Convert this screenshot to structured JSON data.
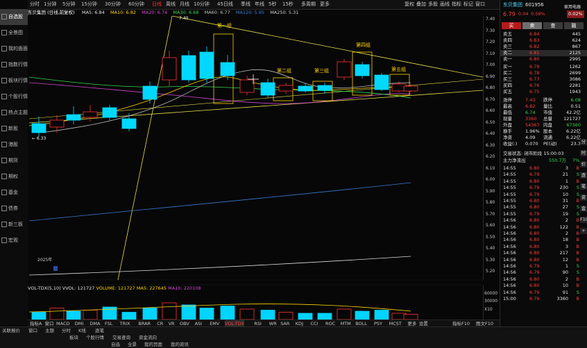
{
  "sidebar": {
    "items": [
      {
        "label": "自选股",
        "active": true
      },
      {
        "label": "全景图"
      },
      {
        "label": "我的面面"
      },
      {
        "label": "指数行情"
      },
      {
        "label": "板块行情"
      },
      {
        "label": "个股行情"
      },
      {
        "label": "热点主题"
      },
      {
        "label": "新股"
      },
      {
        "label": "港股"
      },
      {
        "label": "期货"
      },
      {
        "label": "期权"
      },
      {
        "label": "基金"
      },
      {
        "label": "债券"
      },
      {
        "label": "新三板"
      },
      {
        "label": "宏观"
      }
    ]
  },
  "toolbar": {
    "periods": [
      "分时",
      "1分钟",
      "5分钟",
      "15分钟",
      "30分钟",
      "60分钟",
      "日线",
      "周线",
      "月线",
      "10分钟",
      "45日线",
      "季线",
      "年线",
      "5秒",
      "15秒",
      "多周期",
      "更多"
    ],
    "active_period": "日线",
    "right": [
      "复权",
      "叠加",
      "多股",
      "画线",
      "指标",
      "标记",
      "窗口"
    ]
  },
  "header": {
    "title": "东贝集团 (日线,前复权)",
    "ma5": "MA5: 6.84",
    "ma10": "MA10: 6.82",
    "ma20": "MA20: 6.74",
    "ma30": "MA30: 6.68",
    "ma60": "MA60: 6.77",
    "ma120": "MA120: 5.95",
    "ma250": "MA250: 5.31"
  },
  "annotations": {
    "high_label": "7.40",
    "low_label": "← 6.33",
    "group1": "第一组",
    "group2": "第二组",
    "group3": "第三组",
    "group4": "第四组",
    "group5": "第五组",
    "year_label": "2025年"
  },
  "price_axis": [
    "7.40",
    "7.30",
    "7.20",
    "7.10",
    "7.00",
    "6.90",
    "6.80",
    "6.70",
    "6.60",
    "6.50",
    "6.40",
    "6.30",
    "6.20",
    "6.10",
    "6.00",
    "5.90",
    "5.80",
    "5.70",
    "5.60",
    "5.50",
    "5.40",
    "5.30",
    "5.20"
  ],
  "volume": {
    "header_name": "VOL-TDX(5,10)",
    "vvol": "VVOL: 121727",
    "volume": "VOLUME: 121727",
    "ma5": "MA5: 227645",
    "ma10": "MA10: 220108",
    "axis": [
      "60000",
      "30000",
      "X10"
    ],
    "colors": {
      "up": "#ff3333",
      "down": "#00d4ff",
      "ma5": "#e0e0e0",
      "ma10": "#ffd400"
    }
  },
  "indicator_tabs": [
    "指标A",
    "窗口",
    "MACD",
    "DMI",
    "DMA",
    "FSL",
    "TRIX",
    "BRAR",
    "CR",
    "VR",
    "OBV",
    "ASI",
    "EMV",
    "VOL-TDX",
    "RSI",
    "WR",
    "SAR",
    "KDJ",
    "CCI",
    "ROC",
    "MTM",
    "BOLL",
    "PSY",
    "MCST",
    "更多",
    "设置"
  ],
  "indicator_active": "VOL-TDX",
  "indicator_right": [
    "指标F10",
    "图文F10"
  ],
  "quote": {
    "name": "东贝集团",
    "code": "601956",
    "price": "6.79",
    "change": "0.04",
    "pct": "0.59%",
    "tag": "家用电器",
    "tag_pct": "0.02%",
    "buttons": [
      "买",
      "卖",
      "查",
      "融"
    ],
    "asks": [
      {
        "label": "卖五",
        "price": "6.84",
        "vol": "445"
      },
      {
        "label": "卖四",
        "price": "6.83",
        "vol": "624"
      },
      {
        "label": "卖三",
        "price": "6.82",
        "vol": "867"
      },
      {
        "label": "卖二",
        "price": "6.81",
        "vol": "2125"
      },
      {
        "label": "卖一",
        "price": "6.80",
        "vol": "2995"
      }
    ],
    "bids": [
      {
        "label": "买一",
        "price": "6.79",
        "vol": "1262"
      },
      {
        "label": "买二",
        "price": "6.78",
        "vol": "2699"
      },
      {
        "label": "买三",
        "price": "6.77",
        "vol": "3086"
      },
      {
        "label": "买四",
        "price": "6.76",
        "vol": "2281"
      },
      {
        "label": "买五",
        "price": "6.75",
        "vol": "1943"
      }
    ],
    "stats": [
      {
        "k1": "涨停",
        "v1": "7.43",
        "k2": "跌停",
        "v2": "6.08"
      },
      {
        "k1": "最高",
        "v1": "6.82",
        "k2": "量比",
        "v2": "0.51"
      },
      {
        "k1": "最低",
        "v1": "6.74",
        "k2": "市值",
        "v2": "42.2亿"
      },
      {
        "k1": "现量",
        "v1": "3360",
        "k2": "总量",
        "v2": "121727"
      },
      {
        "k1": "外盘",
        "v1": "54367",
        "k2": "内盘",
        "v2": "67360"
      },
      {
        "k1": "换手",
        "v1": "1.96%",
        "k2": "股本",
        "v2": "6.22亿"
      },
      {
        "k1": "净资",
        "v1": "4.09",
        "k2": "流通",
        "v2": "6.22亿"
      },
      {
        "k1": "收益(-)",
        "v1": "0.070",
        "k2": "PE(动)",
        "v2": "23.3"
      }
    ],
    "trade_status": "交易状态: 闭市阶段 15:00:03",
    "capital_label": "主力净流出",
    "capital_value": "550.7万",
    "capital_pct": "7%",
    "ticks": [
      {
        "t": "14:55",
        "p": "6.80",
        "v": "3",
        "d": "B"
      },
      {
        "t": "14:55",
        "p": "6.79",
        "v": "21",
        "d": "S"
      },
      {
        "t": "14:55",
        "p": "6.80",
        "v": "1",
        "d": "B"
      },
      {
        "t": "14:55",
        "p": "6.79",
        "v": "230",
        "d": "S"
      },
      {
        "t": "14:55",
        "p": "6.79",
        "v": "10",
        "d": "S"
      },
      {
        "t": "14:55",
        "p": "6.80",
        "v": "31",
        "d": "B"
      },
      {
        "t": "14:55",
        "p": "6.80",
        "v": "27",
        "d": "S"
      },
      {
        "t": "14:55",
        "p": "6.79",
        "v": "19",
        "d": "S"
      },
      {
        "t": "14:56",
        "p": "6.80",
        "v": "2",
        "d": "B"
      },
      {
        "t": "14:56",
        "p": "6.80",
        "v": "122",
        "d": "B"
      },
      {
        "t": "14:56",
        "p": "6.80",
        "v": "2",
        "d": "B"
      },
      {
        "t": "14:56",
        "p": "6.80",
        "v": "18",
        "d": "B"
      },
      {
        "t": "14:56",
        "p": "6.80",
        "v": "3",
        "d": "B"
      },
      {
        "t": "14:56",
        "p": "6.80",
        "v": "217",
        "d": "B"
      },
      {
        "t": "14:56",
        "p": "6.80",
        "v": "12",
        "d": "B"
      },
      {
        "t": "14:56",
        "p": "6.79",
        "v": "1",
        "d": "S"
      },
      {
        "t": "14:56",
        "p": "6.79",
        "v": "90",
        "d": "S"
      },
      {
        "t": "14:56",
        "p": "6.80",
        "v": "2",
        "d": "B"
      },
      {
        "t": "14:56",
        "p": "6.80",
        "v": "10",
        "d": "B"
      },
      {
        "t": "14:56",
        "p": "6.79",
        "v": "91",
        "d": "S"
      },
      {
        "t": "15:00",
        "p": "6.79",
        "v": "3360",
        "d": "B"
      }
    ]
  },
  "bottombar": {
    "row1": [
      "关联报价",
      "窗口",
      "主题",
      "分时",
      "K线",
      "逐笔"
    ],
    "row2": [
      "板块",
      "个股行情",
      "交易查询",
      "资金流向"
    ],
    "row3": [
      "自选",
      "全景",
      "我的页面",
      "我的资讯"
    ]
  },
  "side_marks": [
    "分",
    "时",
    "价",
    "逐",
    "笔",
    "资",
    "金",
    "F10",
    "+"
  ]
}
